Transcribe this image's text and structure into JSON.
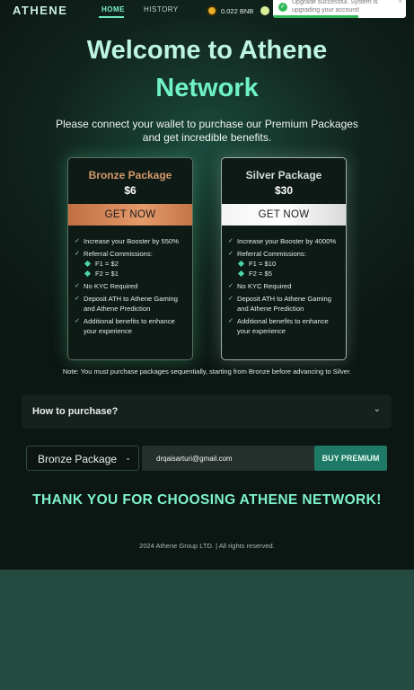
{
  "header": {
    "logo": "ATHENE",
    "nav": {
      "home": "HOME",
      "history": "HISTORY"
    },
    "balance": "0.022 BNB",
    "toast": {
      "message": "Upgrade successful. System is upgrading your account!",
      "close": "×"
    }
  },
  "hero": {
    "title_line1": "Welcome to Athene",
    "title_line2": "Network",
    "subtitle": "Please connect your wallet to purchase our Premium Packages and get incredible benefits."
  },
  "packages": [
    {
      "name": "Bronze Package",
      "price": "$6",
      "cta": "GET NOW",
      "benefits": {
        "booster": "Increase your Booster by 550%",
        "referral": "Referral Commissions:",
        "f1": "F1 = $2",
        "f2": "F2 = $1",
        "kyc": "No KYC Required",
        "deposit": "Deposit ATH to Athene Gaming and Athene Prediction",
        "additional": "Additional benefits to enhance your experience"
      }
    },
    {
      "name": "Silver Package",
      "price": "$30",
      "cta": "GET NOW",
      "benefits": {
        "booster": "Increase your Booster by 4000%",
        "referral": "Referral Commissions:",
        "f1": "F1 = $10",
        "f2": "F2 = $5",
        "kyc": "No KYC Required",
        "deposit": "Deposit ATH to Athene Gaming and Athene Prediction",
        "additional": "Additional benefits to enhance your experience"
      }
    }
  ],
  "note": "Note: You must purchase packages sequentially, starting from Bronze before advancing to Silver.",
  "accordion": {
    "label": "How to purchase?"
  },
  "purchase": {
    "selected_package": "Bronze Package",
    "email": "drqaisarturi@gmail.com",
    "button": "BUY PREMIUM"
  },
  "thanks": "THANK YOU FOR CHOOSING ATHENE NETWORK!",
  "footer": "2024 Athene Group LTD. | All rights reserved.",
  "colors": {
    "accent": "#6ff2c6",
    "bronze": "#d59a6a",
    "button_primary": "#1e7a66",
    "toast_success": "#2fb859"
  }
}
